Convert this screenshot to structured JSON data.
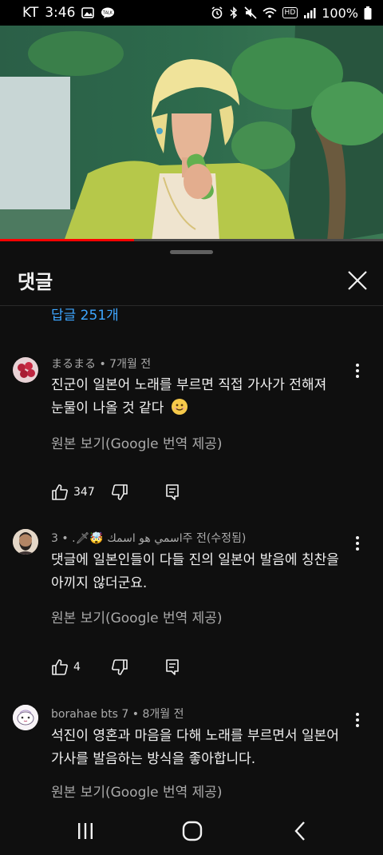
{
  "status_bar": {
    "carrier": "KT",
    "time": "3:46",
    "battery": "100%",
    "hd_badge": "HD",
    "notification_icons": [
      "image-icon",
      "talk-icon"
    ],
    "system_icons": [
      "alarm-icon",
      "bluetooth-icon",
      "mute-icon",
      "wifi-icon",
      "hd-icon",
      "signal-icon",
      "battery-icon"
    ]
  },
  "video": {
    "progress": 0.35
  },
  "comments_panel": {
    "title": "댓글",
    "replies_link": "답글 251개"
  },
  "comments": [
    {
      "author": "まるまる",
      "time": "7개월 전",
      "lines": [
        "진군이 일본어 노래를 부르면 직접 가사가 전해져",
        "눈물이 나올 것 같다"
      ],
      "emoji": "smiling-face-emoji",
      "translate": "원본 보기(Google 번역 제공)",
      "likes": "347"
    },
    {
      "author": "اسمي هو اسمك 🤯🗡.",
      "time": "3주 전(수정됨)",
      "lines": [
        "댓글에 일본인들이 다들 진의 일본어 발음에 칭찬을",
        "아끼지 않더군요."
      ],
      "translate": "원본 보기(Google 번역 제공)",
      "likes": "4"
    },
    {
      "author": "borahae bts 7",
      "time": "8개월 전",
      "lines": [
        "석진이 영혼과 마음을 다해 노래를 부르면서 일본어",
        "가사를 발음하는 방식을 좋아합니다."
      ],
      "translate": "원본 보기(Google 번역 제공)"
    }
  ],
  "colors": {
    "background": "#0f0f0f",
    "link": "#3ea6ff",
    "secondary_text": "#aaaaaa",
    "progress": "#ff0000"
  }
}
